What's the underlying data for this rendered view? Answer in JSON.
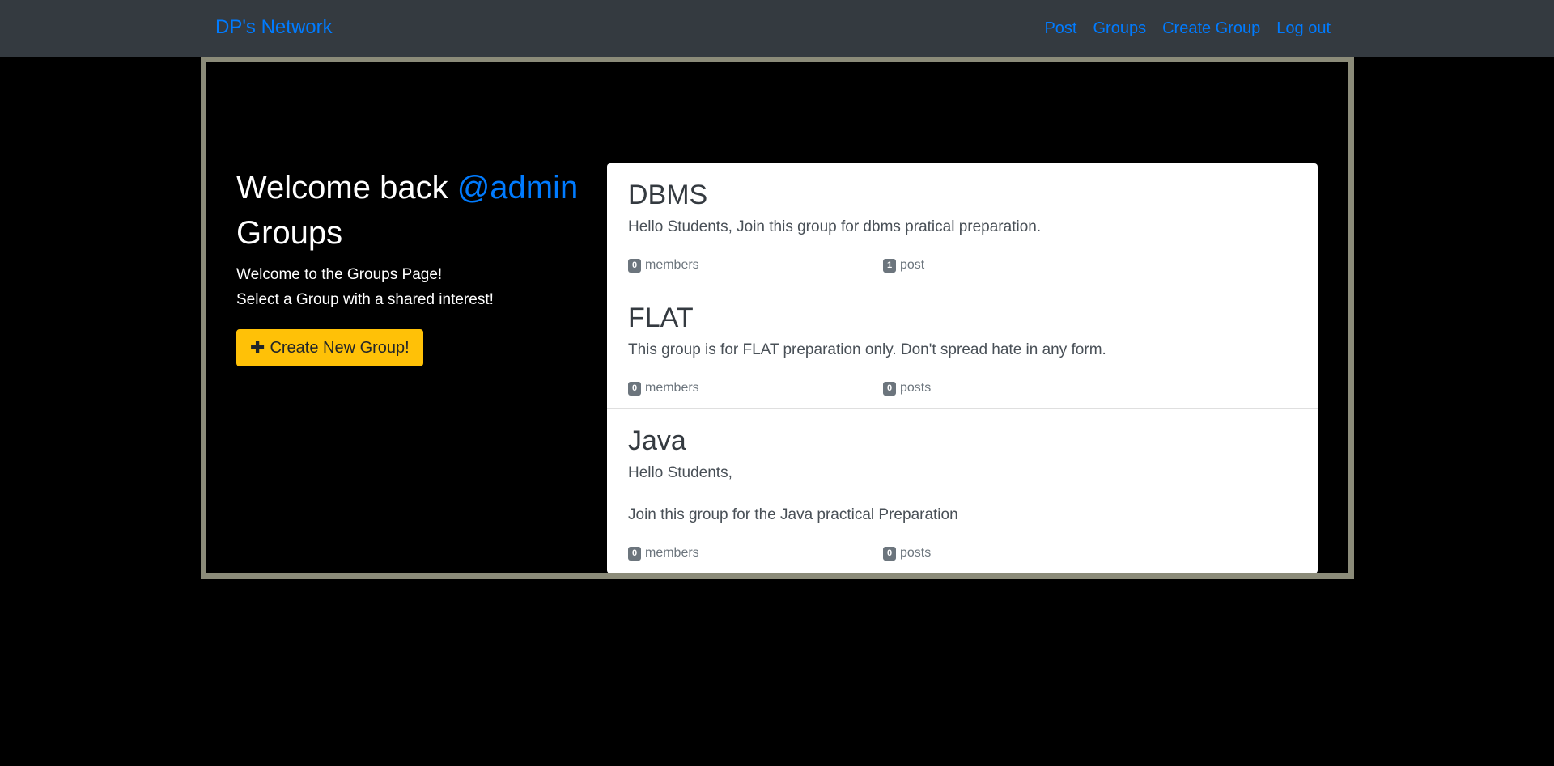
{
  "navbar": {
    "brand": "DP's Network",
    "links": [
      {
        "label": "Post"
      },
      {
        "label": "Groups"
      },
      {
        "label": "Create Group"
      },
      {
        "label": "Log out"
      }
    ]
  },
  "sidebar": {
    "welcome_prefix": "Welcome back ",
    "username": "@admin",
    "heading": "Groups",
    "intro_line1": "Welcome to the Groups Page!",
    "intro_line2": "Select a Group with a shared interest!",
    "create_button_label": "Create New Group!",
    "create_button_icon": "plus-icon"
  },
  "groups": [
    {
      "name": "DBMS",
      "description": "Hello Students, Join this group for dbms pratical preparation.",
      "members_count": "0",
      "members_label": "members",
      "posts_count": "1",
      "posts_label": "post"
    },
    {
      "name": "FLAT",
      "description": "This group is for FLAT preparation only. Don't spread hate in any form.",
      "members_count": "0",
      "members_label": "members",
      "posts_count": "0",
      "posts_label": "posts"
    },
    {
      "name": "Java",
      "description": "Hello Students,\n\nJoin this group for the Java practical Preparation",
      "members_count": "0",
      "members_label": "members",
      "posts_count": "0",
      "posts_label": "posts"
    }
  ],
  "colors": {
    "navbar_bg": "#343a40",
    "link": "#007bff",
    "frame_border": "#8b8b79",
    "button_bg": "#ffc107",
    "badge_bg": "#6c757d"
  }
}
